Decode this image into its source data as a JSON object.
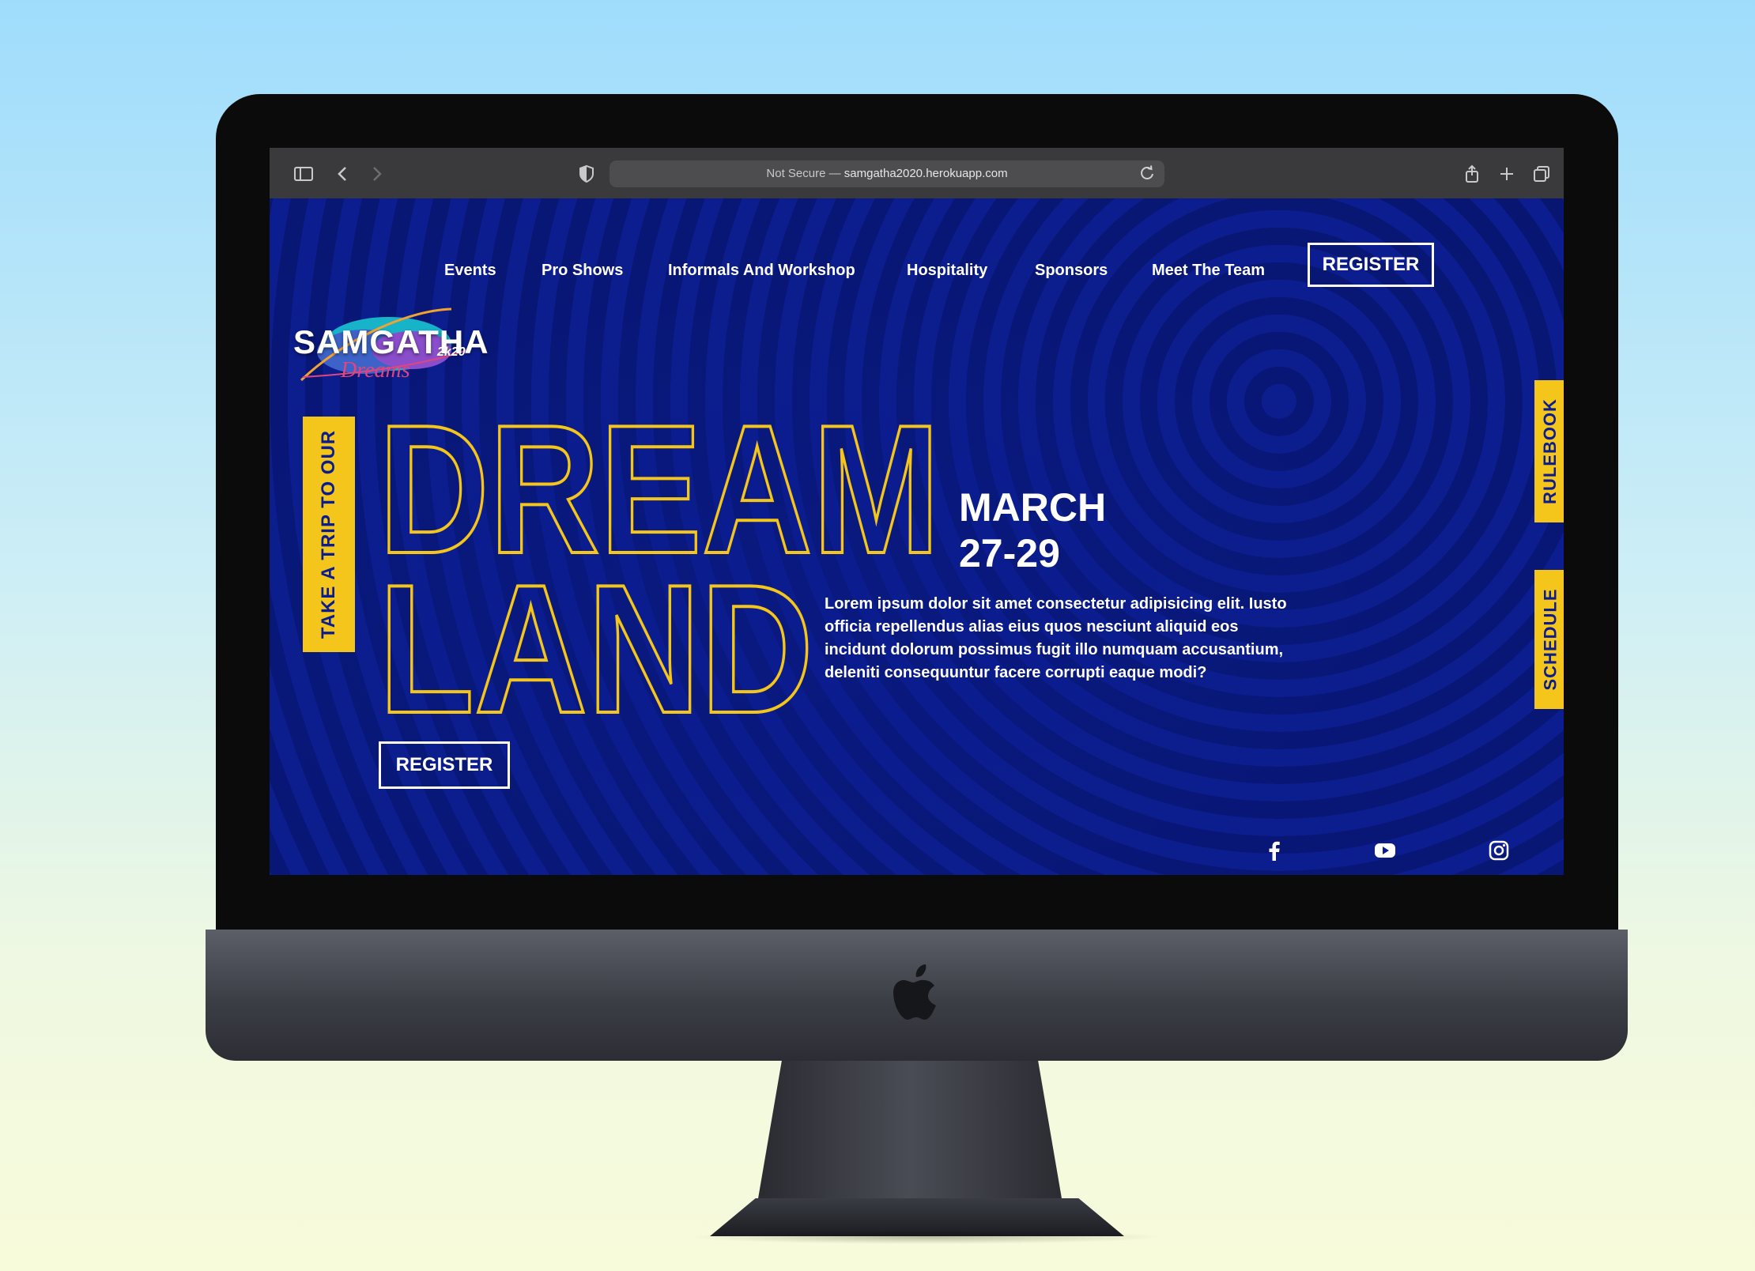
{
  "browser": {
    "address_secure_label": "Not Secure —",
    "address_url": "samgatha2020.herokuapp.com"
  },
  "nav": {
    "items": [
      "Events",
      "Pro Shows",
      "Informals And Workshop",
      "Hospitality",
      "Sponsors",
      "Meet The Team"
    ],
    "register_label": "REGISTER"
  },
  "logo": {
    "name": "SAMGATHA",
    "script": "Dreams",
    "year": "2k20"
  },
  "hero": {
    "tag": "TAKE A TRIP TO OUR",
    "title_line1": "DREAM",
    "title_line2": "LAND",
    "date_month": "MARCH",
    "date_days": "27-29",
    "description": "Lorem ipsum dolor sit amet consectetur adipisicing elit. Iusto officia repellendus alias eius quos nesciunt aliquid eos incidunt dolorum possimus fugit illo numquam accusantium, deleniti consequuntur facere corrupti eaque modi?",
    "register_label": "REGISTER"
  },
  "side_tabs": {
    "rulebook": "RULEBOOK",
    "schedule": "SCHEDULE"
  },
  "social": {
    "icons": [
      "facebook-icon",
      "youtube-icon",
      "instagram-icon"
    ]
  },
  "colors": {
    "page_bg": "#0b1c8e",
    "accent_yellow": "#f4c51b",
    "text": "#ffffff"
  }
}
